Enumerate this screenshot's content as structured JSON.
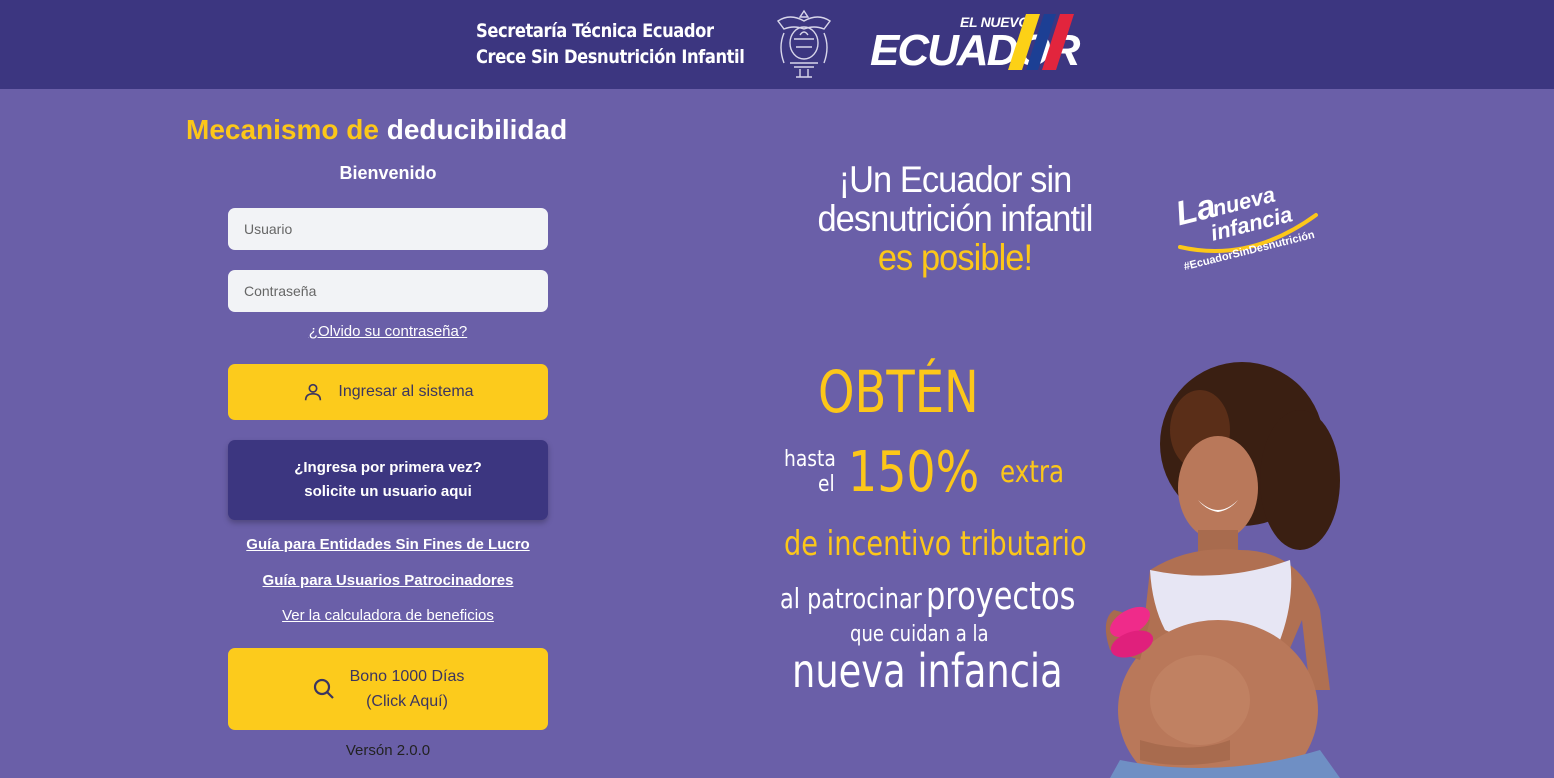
{
  "header": {
    "title_line1": "Secretaría Técnica Ecuador",
    "title_line2": "Crece Sin Desnutrición Infantil",
    "logo_small": "EL NUEVO",
    "logo_big": "ECUADOR"
  },
  "login": {
    "brand_part1": "Mecanismo de",
    "brand_part2": "deducibilidad",
    "welcome": "Bienvenido",
    "username_placeholder": "Usuario",
    "password_placeholder": "Contraseña",
    "forgot_password": "¿Olvido su contraseña?",
    "login_button": "Ingresar al sistema",
    "first_time_line1": "¿Ingresa por primera vez?",
    "first_time_line2": "solicite un usuario aqui",
    "guide_nonprofit": "Guía para Entidades Sin Fines de Lucro",
    "guide_sponsors": "Guía para Usuarios Patrocinadores",
    "calculator_link": "Ver la calculadora de beneficios",
    "bono_line1": "Bono 1000 Días",
    "bono_line2": "(Click Aquí)",
    "version": "Versón 2.0.0"
  },
  "hero": {
    "slogan_line1": "¡Un Ecuador sin",
    "slogan_line2": "desnutrición infantil",
    "slogan_line3": "es posible!",
    "campaign_la": "La",
    "campaign_nueva": "nueva",
    "campaign_infancia": "infancia",
    "campaign_hashtag": "#EcuadorSinDesnutrición",
    "promo_obten": "OBTÉN",
    "promo_hasta": "hasta",
    "promo_el": "el",
    "promo_percent": "150%",
    "promo_extra": "extra",
    "promo_incentivo": "de incentivo tributario",
    "promo_al_patrocinar": "al patrocinar",
    "promo_proyectos": "proyectos",
    "promo_que_cuidan": "que cuidan a la",
    "promo_nueva_infancia": "nueva infancia"
  },
  "colors": {
    "header_bg": "#3c3680",
    "page_bg": "#6a5fa8",
    "accent_yellow": "#fcc719",
    "dark_button": "#3c3680"
  },
  "icons": {
    "login": "user-icon",
    "bono": "search-icon",
    "emblem": "coat-of-arms-icon"
  }
}
